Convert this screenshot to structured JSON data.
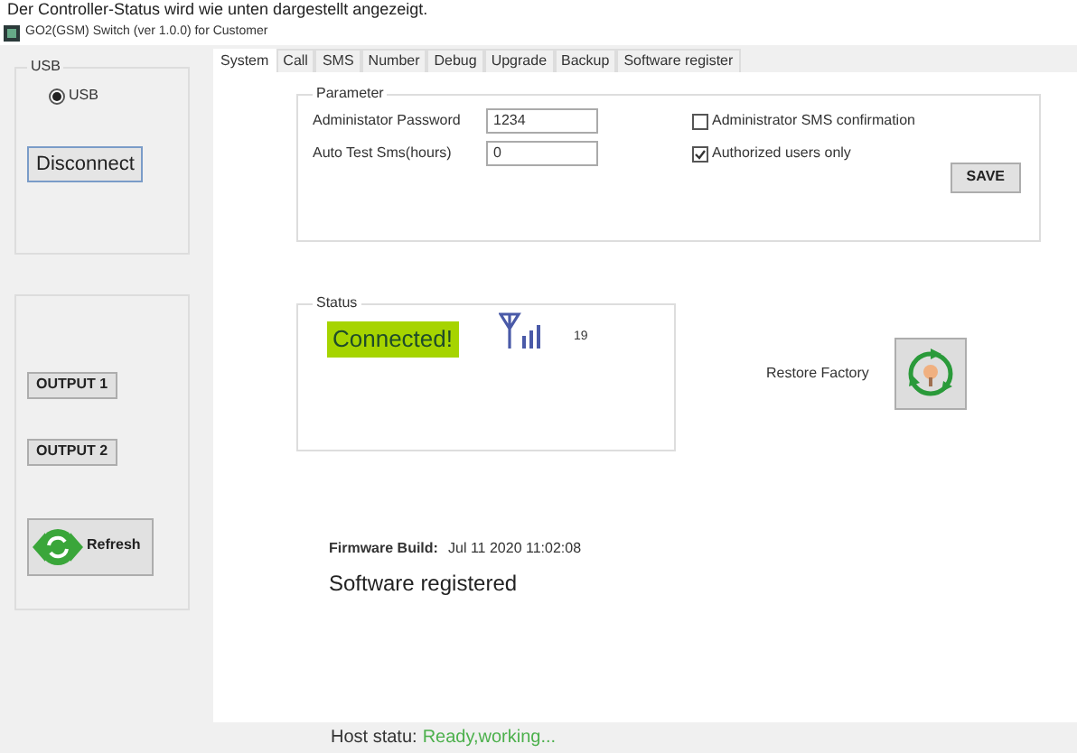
{
  "caption": "Der Controller-Status wird wie unten dargestellt angezeigt.",
  "window": {
    "title": "GO2(GSM) Switch (ver 1.0.0) for Customer"
  },
  "sidebar": {
    "usb_group": {
      "title": "USB",
      "radios": [
        {
          "label": "USB",
          "selected": true
        }
      ],
      "button": "Disconnect"
    },
    "outputs": [
      "OUTPUT 1",
      "OUTPUT 2"
    ],
    "refresh_button": "Refresh"
  },
  "tabs": [
    {
      "label": "System",
      "selected": true
    },
    {
      "label": "Call",
      "selected": false
    },
    {
      "label": "SMS",
      "selected": false
    },
    {
      "label": "Number",
      "selected": false
    },
    {
      "label": "Debug",
      "selected": false
    },
    {
      "label": "Upgrade",
      "selected": false
    },
    {
      "label": "Backup",
      "selected": false
    },
    {
      "label": "Software register",
      "selected": false
    }
  ],
  "parameter": {
    "title": "Parameter",
    "fields": [
      {
        "label": "Administator Password",
        "value": "1234"
      },
      {
        "label": "Auto Test Sms(hours)",
        "value": "0"
      }
    ],
    "checkboxes": [
      {
        "label": "Administrator SMS confirmation",
        "checked": false
      },
      {
        "label": "Authorized users only",
        "checked": true
      }
    ],
    "save_button": "SAVE"
  },
  "status": {
    "title": "Status",
    "connection": "Connected!",
    "signal": "19"
  },
  "restore_factory": {
    "label": "Restore Factory"
  },
  "firmware": {
    "label": "Firmware Build:",
    "value": "Jul 11 2020 11:02:08"
  },
  "registration": "Software registered",
  "status_bar": {
    "label": "Host statu:",
    "value": "Ready,working..."
  }
}
